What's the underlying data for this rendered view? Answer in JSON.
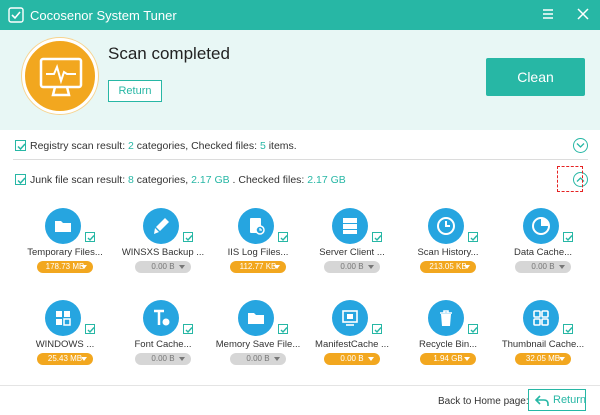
{
  "window": {
    "title": "Cocosenor System Tuner"
  },
  "header": {
    "status": "Scan completed",
    "return_label": "Return",
    "clean_label": "Clean"
  },
  "registry": {
    "prefix": "Registry scan result: ",
    "categories": "2",
    "mid": " categories, Checked files: ",
    "files": "5",
    "suffix": " items."
  },
  "junk": {
    "prefix": "Junk file scan result: ",
    "categories": "8",
    "mid1": " categories, ",
    "size1": "2.17 GB",
    "mid2": " . Checked files: ",
    "size2": "2.17 GB"
  },
  "items": [
    {
      "label": "Temporary Files...",
      "size": "178.73 MB",
      "active": true,
      "icon": "folder-icon"
    },
    {
      "label": "WINSXS Backup ...",
      "size": "0.00 B",
      "active": false,
      "icon": "brush-icon"
    },
    {
      "label": "IIS Log Files...",
      "size": "112.77 KB",
      "active": true,
      "icon": "log-file-icon"
    },
    {
      "label": "Server Client ...",
      "size": "0.00 B",
      "active": false,
      "icon": "server-icon"
    },
    {
      "label": "Scan History...",
      "size": "213.05 KB",
      "active": true,
      "icon": "clock-icon"
    },
    {
      "label": "Data Cache...",
      "size": "0.00 B",
      "active": false,
      "icon": "pie-icon"
    },
    {
      "label": "WINDOWS ...",
      "size": "25.43 MB",
      "active": true,
      "icon": "windows-icon"
    },
    {
      "label": "Font Cache...",
      "size": "0.00 B",
      "active": false,
      "icon": "font-icon"
    },
    {
      "label": "Memory Save File...",
      "size": "0.00 B",
      "active": false,
      "icon": "folder-icon"
    },
    {
      "label": "ManifestCache ...",
      "size": "0.00 B",
      "active": true,
      "icon": "windows-logo-icon"
    },
    {
      "label": "Recycle Bin...",
      "size": "1.94 GB",
      "active": true,
      "icon": "recycle-bin-icon"
    },
    {
      "label": "Thumbnail Cache...",
      "size": "32.05 MB",
      "active": true,
      "icon": "thumbnail-grid-icon"
    }
  ],
  "footer": {
    "back_label": "Back to Home page:",
    "return_label": "Return"
  },
  "colors": {
    "accent": "#27b7a5",
    "orange": "#f2a71f",
    "blue": "#26a5e0",
    "gray_pill": "#d6d6d6",
    "red_dash": "#e52222"
  }
}
